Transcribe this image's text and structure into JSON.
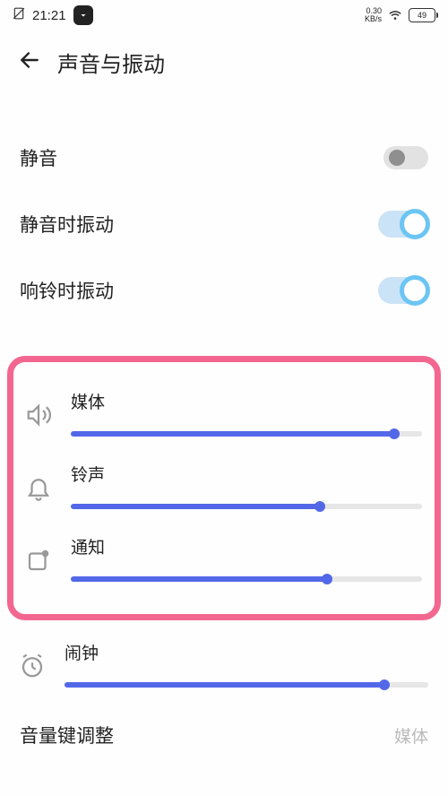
{
  "status": {
    "time": "21:21",
    "net_speed_value": "0.30",
    "net_speed_unit": "KB/s",
    "battery": "49"
  },
  "header": {
    "title": "声音与振动"
  },
  "toggles": {
    "silent": {
      "label": "静音",
      "on": false
    },
    "vibrate_silent": {
      "label": "静音时振动",
      "on": true
    },
    "vibrate_ring": {
      "label": "响铃时振动",
      "on": true
    }
  },
  "sliders": {
    "media": {
      "label": "媒体",
      "percent": 92
    },
    "ringtone": {
      "label": "铃声",
      "percent": 71
    },
    "notification": {
      "label": "通知",
      "percent": 73
    },
    "alarm": {
      "label": "闹钟",
      "percent": 88
    }
  },
  "footer": {
    "label": "音量键调整",
    "value": "媒体"
  },
  "colors": {
    "accent": "#5368e8",
    "toggle_on_ring": "#6cc5f3",
    "highlight": "#f3668f"
  }
}
